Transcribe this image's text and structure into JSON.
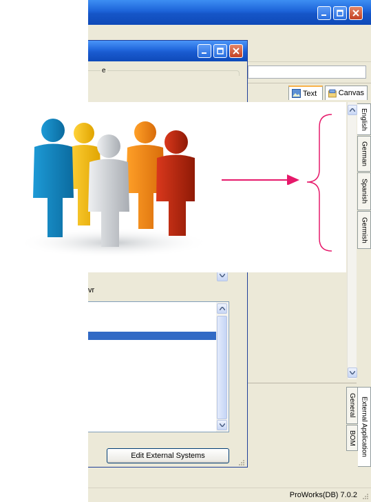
{
  "main_tabs": {
    "text_label": "Text",
    "canvas_label": "Canvas"
  },
  "language_tabs": [
    "English",
    "German",
    "Spanish",
    "Germish"
  ],
  "bottom_tabs": [
    "General",
    "BOM",
    "External Application"
  ],
  "dialog": {
    "group_caption_fragment": "e",
    "label_fragment": "vr",
    "edit_button_label": "Edit External Systems"
  },
  "status": {
    "version": "ProWorks(DB) 7.0.2"
  },
  "icons": {
    "people_illustration": "people-group-icon",
    "arrow": "right-arrow-icon",
    "brace": "curly-brace-icon"
  },
  "colors": {
    "titlebar_blue": "#1c63d8",
    "close_red": "#c44124",
    "arrow_pink": "#e6186a",
    "selection_blue": "#316ac5",
    "window_face": "#ece9d8"
  }
}
